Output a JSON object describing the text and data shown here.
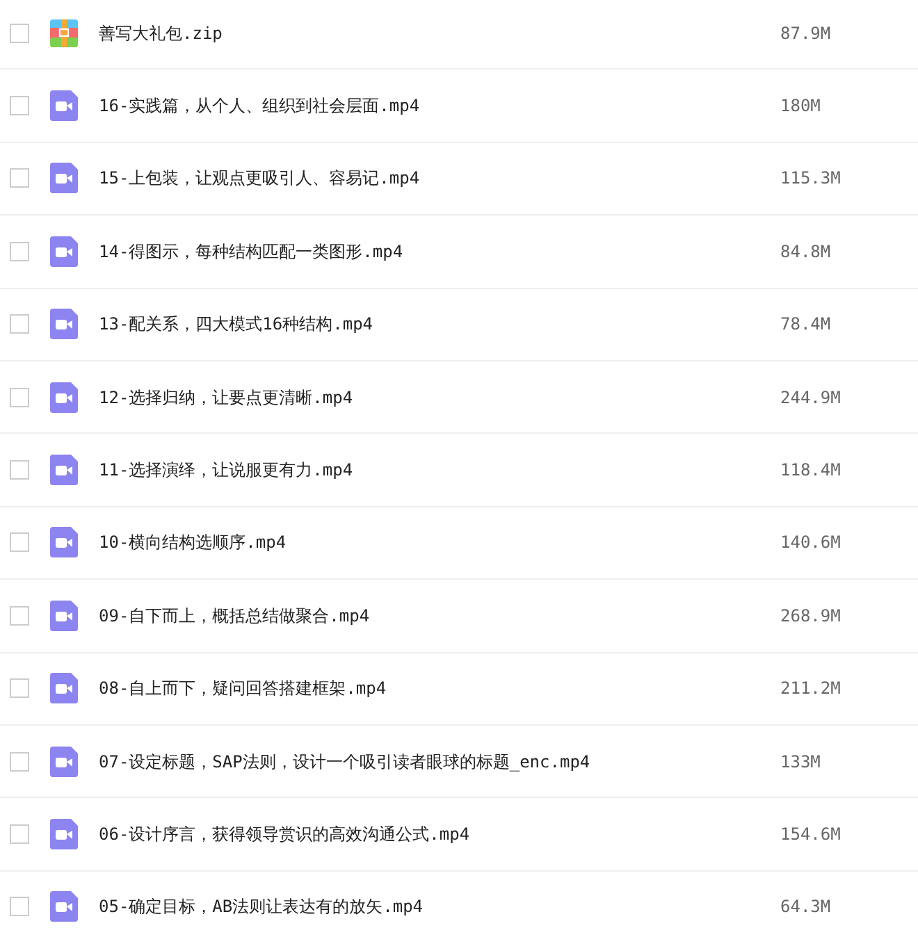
{
  "files": [
    {
      "kind": "zip",
      "name": "善写大礼包.zip",
      "size": "87.9M",
      "checked": false
    },
    {
      "kind": "video",
      "name": "16-实践篇，从个人、组织到社会层面.mp4",
      "size": "180M",
      "checked": false
    },
    {
      "kind": "video",
      "name": "15-上包装，让观点更吸引人、容易记.mp4",
      "size": "115.3M",
      "checked": false
    },
    {
      "kind": "video",
      "name": "14-得图示，每种结构匹配一类图形.mp4",
      "size": "84.8M",
      "checked": false
    },
    {
      "kind": "video",
      "name": "13-配关系，四大模式16种结构.mp4",
      "size": "78.4M",
      "checked": false
    },
    {
      "kind": "video",
      "name": "12-选择归纳，让要点更清晰.mp4",
      "size": "244.9M",
      "checked": false
    },
    {
      "kind": "video",
      "name": "11-选择演绎，让说服更有力.mp4",
      "size": "118.4M",
      "checked": false
    },
    {
      "kind": "video",
      "name": "10-横向结构选顺序.mp4",
      "size": "140.6M",
      "checked": false
    },
    {
      "kind": "video",
      "name": "09-自下而上，概括总结做聚合.mp4",
      "size": "268.9M",
      "checked": false
    },
    {
      "kind": "video",
      "name": "08-自上而下，疑问回答搭建框架.mp4",
      "size": "211.2M",
      "checked": false
    },
    {
      "kind": "video",
      "name": "07-设定标题，SAP法则，设计一个吸引读者眼球的标题_enc.mp4",
      "size": "133M",
      "checked": false
    },
    {
      "kind": "video",
      "name": "06-设计序言，获得领导赏识的高效沟通公式.mp4",
      "size": "154.6M",
      "checked": false
    },
    {
      "kind": "video",
      "name": "05-确定目标，AB法则让表达有的放矢.mp4",
      "size": "64.3M",
      "checked": false
    }
  ]
}
